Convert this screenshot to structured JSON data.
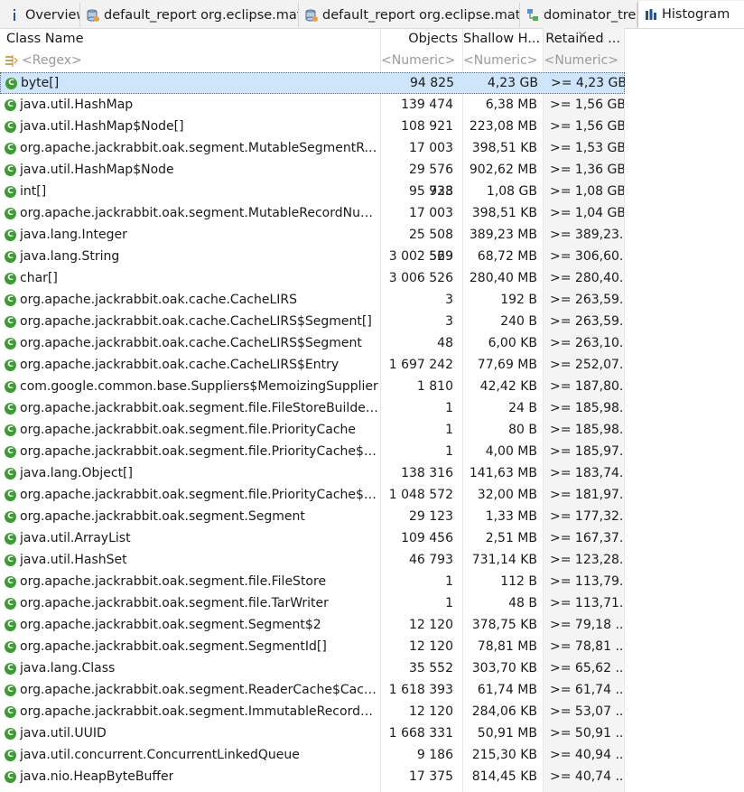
{
  "tabs": [
    {
      "label": "Overview",
      "icon": "info-icon"
    },
    {
      "label": "default_report  org.eclipse.mat....",
      "icon": "report-icon"
    },
    {
      "label": "default_report  org.eclipse.mat....",
      "icon": "report-icon"
    },
    {
      "label": "dominator_tree",
      "icon": "tree-icon"
    },
    {
      "label": "Histogram",
      "icon": "histogram-icon",
      "active": true
    }
  ],
  "columns": {
    "class_name": "Class Name",
    "objects": "Objects",
    "shallow": "Shallow H...",
    "retained": "Retained ..."
  },
  "filters": {
    "class_name": "<Regex>",
    "objects": "<Numeric>",
    "shallow": "<Numeric>",
    "retained": "<Numeric>"
  },
  "rows": [
    {
      "name": "byte[]",
      "objects": "94 825",
      "shallow": "4,23 GB",
      "retained": ">= 4,23 GB",
      "selected": true
    },
    {
      "name": "java.util.HashMap",
      "objects": "139 474",
      "shallow": "6,38 MB",
      "retained": ">= 1,56 GB"
    },
    {
      "name": "java.util.HashMap$Node[]",
      "objects": "108 921",
      "shallow": "223,08 MB",
      "retained": ">= 1,56 GB"
    },
    {
      "name": "org.apache.jackrabbit.oak.segment.MutableSegmentRefer...",
      "objects": "17 003",
      "shallow": "398,51 KB",
      "retained": ">= 1,53 GB"
    },
    {
      "name": "java.util.HashMap$Node",
      "objects": "29 576 923",
      "shallow": "902,62 MB",
      "retained": ">= 1,36 GB"
    },
    {
      "name": "int[]",
      "objects": "95 738",
      "shallow": "1,08 GB",
      "retained": ">= 1,08 GB"
    },
    {
      "name": "org.apache.jackrabbit.oak.segment.MutableRecordNumbers",
      "objects": "17 003",
      "shallow": "398,51 KB",
      "retained": ">= 1,04 GB"
    },
    {
      "name": "java.lang.Integer",
      "objects": "25 508 529",
      "shallow": "389,23 MB",
      "retained": ">= 389,23..."
    },
    {
      "name": "java.lang.String",
      "objects": "3 002 569",
      "shallow": "68,72 MB",
      "retained": ">= 306,60..."
    },
    {
      "name": "char[]",
      "objects": "3 006 526",
      "shallow": "280,40 MB",
      "retained": ">= 280,40..."
    },
    {
      "name": "org.apache.jackrabbit.oak.cache.CacheLIRS",
      "objects": "3",
      "shallow": "192 B",
      "retained": ">= 263,59..."
    },
    {
      "name": "org.apache.jackrabbit.oak.cache.CacheLIRS$Segment[]",
      "objects": "3",
      "shallow": "240 B",
      "retained": ">= 263,59..."
    },
    {
      "name": "org.apache.jackrabbit.oak.cache.CacheLIRS$Segment",
      "objects": "48",
      "shallow": "6,00 KB",
      "retained": ">= 263,10..."
    },
    {
      "name": "org.apache.jackrabbit.oak.cache.CacheLIRS$Entry",
      "objects": "1 697 242",
      "shallow": "77,69 MB",
      "retained": ">= 252,07..."
    },
    {
      "name": "com.google.common.base.Suppliers$MemoizingSupplier",
      "objects": "1 810",
      "shallow": "42,42 KB",
      "retained": ">= 187,80..."
    },
    {
      "name": "org.apache.jackrabbit.oak.segment.file.FileStoreBuilder$Ev...",
      "objects": "1",
      "shallow": "24 B",
      "retained": ">= 185,98..."
    },
    {
      "name": "org.apache.jackrabbit.oak.segment.file.PriorityCache",
      "objects": "1",
      "shallow": "80 B",
      "retained": ">= 185,98..."
    },
    {
      "name": "org.apache.jackrabbit.oak.segment.file.PriorityCache$Entry[]",
      "objects": "1",
      "shallow": "4,00 MB",
      "retained": ">= 185,97..."
    },
    {
      "name": "java.lang.Object[]",
      "objects": "138 316",
      "shallow": "141,63 MB",
      "retained": ">= 183,74..."
    },
    {
      "name": "org.apache.jackrabbit.oak.segment.file.PriorityCache$Entry",
      "objects": "1 048 572",
      "shallow": "32,00 MB",
      "retained": ">= 181,97..."
    },
    {
      "name": "org.apache.jackrabbit.oak.segment.Segment",
      "objects": "29 123",
      "shallow": "1,33 MB",
      "retained": ">= 177,32..."
    },
    {
      "name": "java.util.ArrayList",
      "objects": "109 456",
      "shallow": "2,51 MB",
      "retained": ">= 167,37..."
    },
    {
      "name": "java.util.HashSet",
      "objects": "46 793",
      "shallow": "731,14 KB",
      "retained": ">= 123,28..."
    },
    {
      "name": "org.apache.jackrabbit.oak.segment.file.FileStore",
      "objects": "1",
      "shallow": "112 B",
      "retained": ">= 113,79..."
    },
    {
      "name": "org.apache.jackrabbit.oak.segment.file.TarWriter",
      "objects": "1",
      "shallow": "48 B",
      "retained": ">= 113,71..."
    },
    {
      "name": "org.apache.jackrabbit.oak.segment.Segment$2",
      "objects": "12 120",
      "shallow": "378,75 KB",
      "retained": ">= 79,18 ..."
    },
    {
      "name": "org.apache.jackrabbit.oak.segment.SegmentId[]",
      "objects": "12 120",
      "shallow": "78,81 MB",
      "retained": ">= 78,81 ..."
    },
    {
      "name": "java.lang.Class",
      "objects": "35 552",
      "shallow": "303,70 KB",
      "retained": ">= 65,62 ..."
    },
    {
      "name": "org.apache.jackrabbit.oak.segment.ReaderCache$CacheKey",
      "objects": "1 618 393",
      "shallow": "61,74 MB",
      "retained": ">= 61,74 ..."
    },
    {
      "name": "org.apache.jackrabbit.oak.segment.ImmutableRecordNum...",
      "objects": "12 120",
      "shallow": "284,06 KB",
      "retained": ">= 53,07 ..."
    },
    {
      "name": "java.util.UUID",
      "objects": "1 668 331",
      "shallow": "50,91 MB",
      "retained": ">= 50,91 ..."
    },
    {
      "name": "java.util.concurrent.ConcurrentLinkedQueue",
      "objects": "9 186",
      "shallow": "215,30 KB",
      "retained": ">= 40,94 ..."
    },
    {
      "name": "java.nio.HeapByteBuffer",
      "objects": "17 375",
      "shallow": "814,45 KB",
      "retained": ">= 40,74 ..."
    }
  ],
  "colors": {
    "class_icon": "#3f9c35",
    "selection": "#cfe5fb",
    "filter_text": "#9a9a9a"
  }
}
